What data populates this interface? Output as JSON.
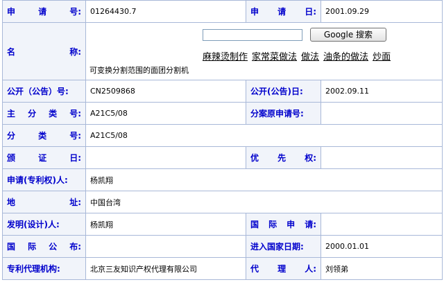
{
  "fields": {
    "application_no": {
      "label": "申请号:",
      "value": "01264430.7"
    },
    "application_date": {
      "label": "申请日:",
      "value": "2001.09.29"
    },
    "name": {
      "label": "名称:",
      "value": "可变换分割范围的面团分割机"
    },
    "publication_no": {
      "label": "公开（公告）号:",
      "value": "CN2509868"
    },
    "publication_date": {
      "label": "公开(公告)日:",
      "value": "2002.09.11"
    },
    "main_class": {
      "label": "主分类号:",
      "value": "A21C5/08"
    },
    "division_original": {
      "label": "分案原申请号:",
      "value": ""
    },
    "classification": {
      "label": "分类号:",
      "value": "A21C5/08"
    },
    "issue_date": {
      "label": "颁证日:",
      "value": ""
    },
    "priority": {
      "label": "优先权:",
      "value": ""
    },
    "applicant": {
      "label": "申请(专利权)人:",
      "value": "杨凯翔"
    },
    "address": {
      "label": "地址:",
      "value": "中国台湾"
    },
    "inventor": {
      "label": "发明(设计)人:",
      "value": "杨凯翔"
    },
    "intl_application": {
      "label": "国际申请:",
      "value": ""
    },
    "intl_publication": {
      "label": "国际公布:",
      "value": ""
    },
    "national_entry_date": {
      "label": "进入国家日期:",
      "value": "2000.01.01"
    },
    "agency": {
      "label": "专利代理机构:",
      "value": "北京三友知识产权代理有限公司"
    },
    "agent": {
      "label": "代理人:",
      "value": "刘领弟"
    }
  },
  "search": {
    "placeholder": "",
    "button_label": "Google 搜索"
  },
  "ad_links": [
    "麻辣烫制作",
    "家常菜做法",
    "做法",
    "油条的做法",
    "炒面"
  ]
}
